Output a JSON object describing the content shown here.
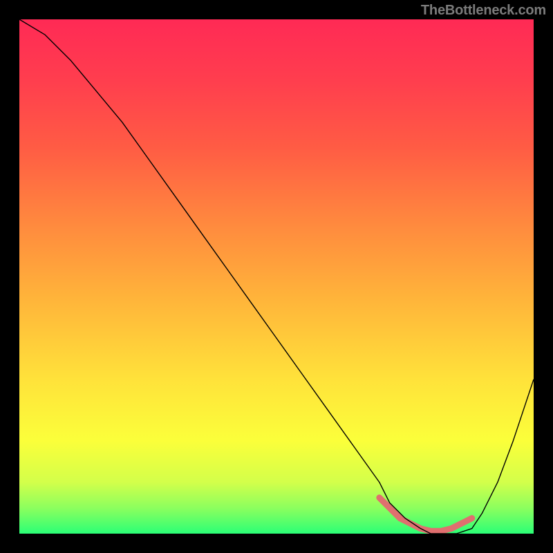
{
  "watermark": "TheBottleneck.com",
  "chart_data": {
    "type": "line",
    "title": "",
    "xlabel": "",
    "ylabel": "",
    "xlim": [
      0,
      100
    ],
    "ylim": [
      0,
      100
    ],
    "grid": false,
    "legend": false,
    "background_gradient": {
      "stops": [
        {
          "offset": 0.0,
          "color": "#ff2a55"
        },
        {
          "offset": 0.12,
          "color": "#ff3e4e"
        },
        {
          "offset": 0.25,
          "color": "#ff5c44"
        },
        {
          "offset": 0.4,
          "color": "#ff8a3e"
        },
        {
          "offset": 0.55,
          "color": "#ffb63a"
        },
        {
          "offset": 0.7,
          "color": "#ffe23a"
        },
        {
          "offset": 0.82,
          "color": "#fbff3a"
        },
        {
          "offset": 0.9,
          "color": "#d3ff4a"
        },
        {
          "offset": 0.95,
          "color": "#8cff5e"
        },
        {
          "offset": 1.0,
          "color": "#2bff76"
        }
      ]
    },
    "series": [
      {
        "name": "bottleneck-curve",
        "color": "#000000",
        "stroke_width": 1.4,
        "x": [
          0,
          5,
          10,
          15,
          20,
          25,
          30,
          35,
          40,
          45,
          50,
          55,
          60,
          65,
          70,
          72,
          75,
          78,
          80,
          83,
          85,
          88,
          90,
          93,
          96,
          100
        ],
        "y": [
          100,
          97,
          92,
          86,
          80,
          73,
          66,
          59,
          52,
          45,
          38,
          31,
          24,
          17,
          10,
          6,
          3,
          1,
          0,
          0,
          0,
          1,
          4,
          10,
          18,
          30
        ]
      }
    ],
    "marker_band": {
      "name": "optimal-range",
      "color": "#e06f6f",
      "stroke_width": 9,
      "x": [
        70,
        72,
        74,
        76,
        78,
        80,
        82,
        84,
        86,
        88
      ],
      "y": [
        7,
        5,
        3,
        2,
        1,
        0.5,
        0.5,
        1,
        2,
        3
      ]
    }
  }
}
